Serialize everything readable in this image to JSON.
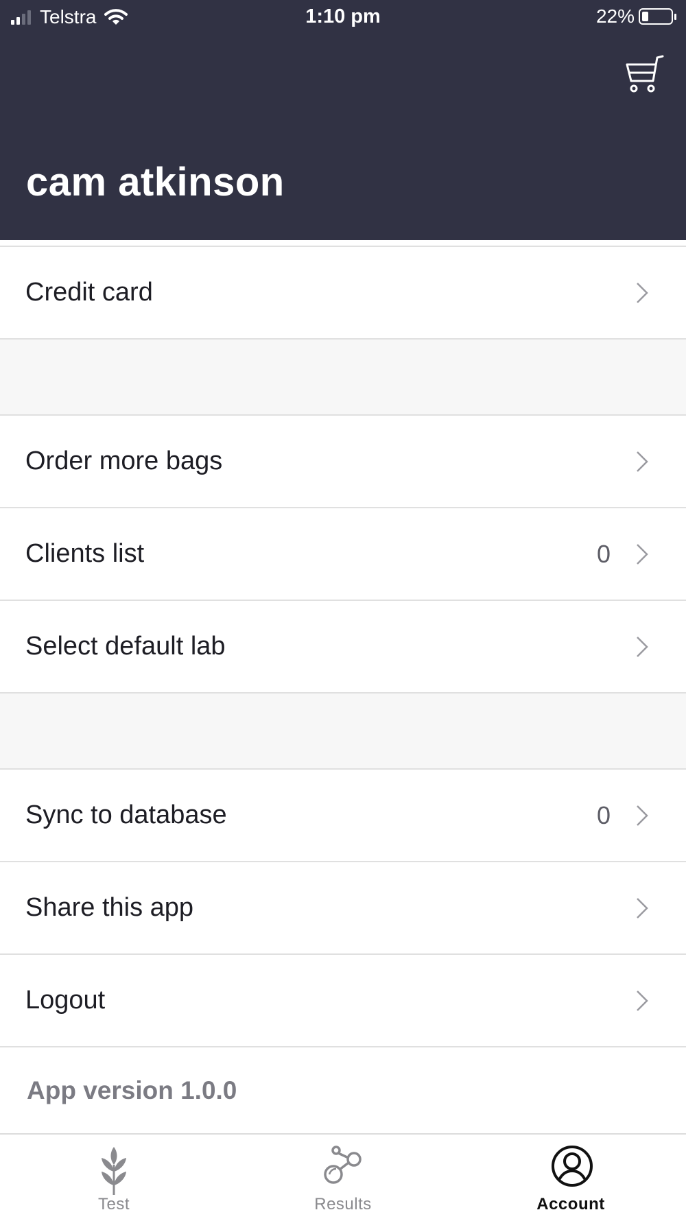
{
  "status_bar": {
    "carrier": "Telstra",
    "time": "1:10 pm",
    "battery": "22%",
    "battery_level": 0.22
  },
  "header": {
    "user_name": "cam atkinson",
    "cart_icon": "shopping-cart-icon"
  },
  "menu": {
    "credit_card": "Credit card",
    "order_bags": "Order more bags",
    "clients_list": "Clients list",
    "clients_count": "0",
    "default_lab": "Select default lab",
    "sync_database": "Sync to database",
    "sync_count": "0",
    "share_app": "Share this app",
    "logout": "Logout"
  },
  "app_version": "App version 1.0.0",
  "tabs": {
    "test": "Test",
    "results": "Results",
    "account": "Account",
    "active": "account"
  },
  "colors": {
    "header_bg": "#313244",
    "section_gap": "#f7f7f7",
    "active_tab": "#111111",
    "inactive_tab": "#8a8a8e"
  }
}
